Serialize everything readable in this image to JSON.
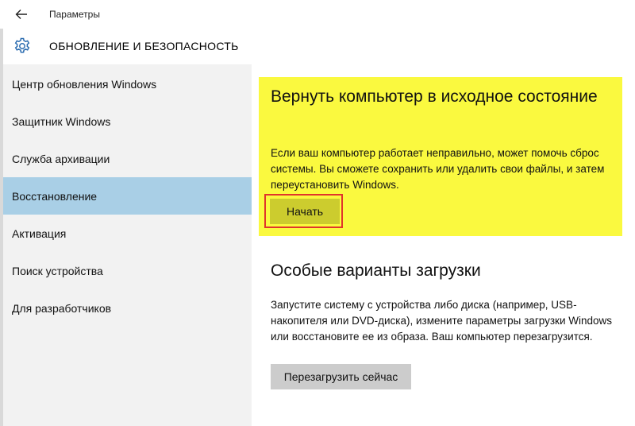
{
  "window": {
    "title": "Параметры",
    "back_icon": "back-arrow-icon"
  },
  "header": {
    "icon": "gear-icon",
    "title": "ОБНОВЛЕНИЕ И БЕЗОПАСНОСТЬ"
  },
  "sidebar": {
    "items": [
      {
        "label": "Центр обновления Windows",
        "selected": false
      },
      {
        "label": "Защитник Windows",
        "selected": false
      },
      {
        "label": "Служба архивации",
        "selected": false
      },
      {
        "label": "Восстановление",
        "selected": true
      },
      {
        "label": "Активация",
        "selected": false
      },
      {
        "label": "Поиск устройства",
        "selected": false
      },
      {
        "label": "Для разработчиков",
        "selected": false
      }
    ],
    "selected_color": "#a9cfe6"
  },
  "reset": {
    "heading": "Вернуть компьютер в исходное состояние",
    "description": "Если ваш компьютер работает неправильно, может помочь сброс системы. Вы сможете сохранить или удалить свои файлы, и затем переустановить Windows.",
    "button_label": "Начать",
    "highlight_color": "#faf93f",
    "outline_color": "#e0352b"
  },
  "advanced_startup": {
    "heading": "Особые варианты загрузки",
    "description": "Запустите систему с устройства либо диска (например, USB-накопителя или DVD-диска), измените параметры загрузки Windows или восстановите ее из образа. Ваш компьютер перезагрузится.",
    "button_label": "Перезагрузить сейчас"
  }
}
